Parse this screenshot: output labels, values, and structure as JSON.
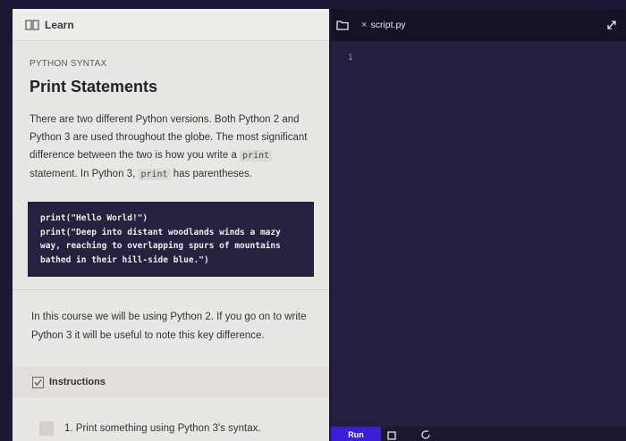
{
  "learn": {
    "header_title": "Learn",
    "syntax_label": "PYTHON SYNTAX",
    "page_title": "Print Statements",
    "para1": {
      "part1": "There are two different Python versions. Both Python 2 and Python 3 are used throughout the globe. The most significant difference between the two is how you write a ",
      "code1": "print",
      "part2": " statement. In Python 3, ",
      "code2": "print",
      "part3": " has parentheses."
    },
    "code_lines": [
      "print(\"Hello World!\")",
      "print(\"Deep into distant woodlands winds a mazy",
      "way, reaching to overlapping spurs of mountains",
      "bathed in their hill-side blue.\")"
    ],
    "para2": "In this course we will be using Python 2. If you go on to write Python 3 it will be useful to note this key difference.",
    "instructions_label": "Instructions",
    "task_1": "1. Print something using Python 3's syntax."
  },
  "editor": {
    "tab_close": "×",
    "tab_name": "script.py",
    "line_number": "1",
    "run_label": "Run"
  },
  "colors": {
    "accent": "#3a1fd6",
    "editor_bg": "#22203e",
    "panel_bg": "#e9e7e3"
  }
}
